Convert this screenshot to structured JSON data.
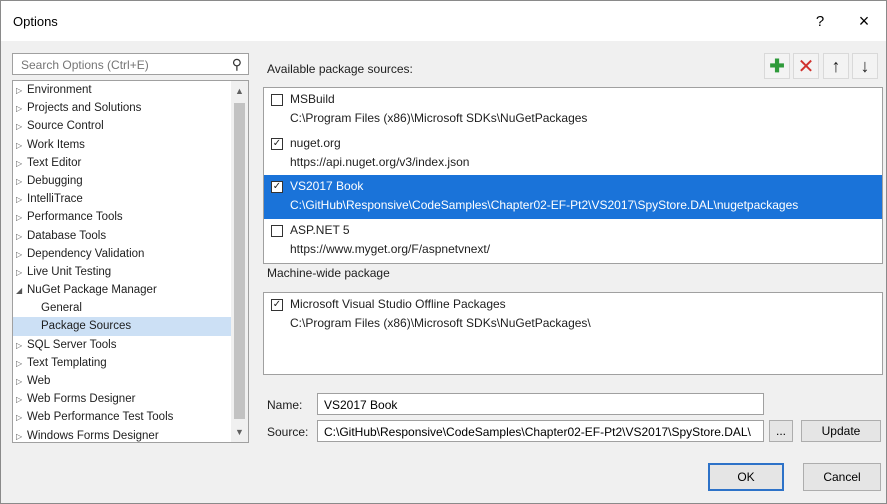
{
  "window": {
    "title": "Options",
    "help_label": "?",
    "close_label": "×"
  },
  "search": {
    "placeholder": "Search Options (Ctrl+E)",
    "value": ""
  },
  "tree": {
    "items": [
      {
        "label": "Environment",
        "expanded": false
      },
      {
        "label": "Projects and Solutions",
        "expanded": false
      },
      {
        "label": "Source Control",
        "expanded": false
      },
      {
        "label": "Work Items",
        "expanded": false
      },
      {
        "label": "Text Editor",
        "expanded": false
      },
      {
        "label": "Debugging",
        "expanded": false
      },
      {
        "label": "IntelliTrace",
        "expanded": false
      },
      {
        "label": "Performance Tools",
        "expanded": false
      },
      {
        "label": "Database Tools",
        "expanded": false
      },
      {
        "label": "Dependency Validation",
        "expanded": false
      },
      {
        "label": "Live Unit Testing",
        "expanded": false
      },
      {
        "label": "NuGet Package Manager",
        "expanded": true
      },
      {
        "label": "General",
        "child": true
      },
      {
        "label": "Package Sources",
        "child": true,
        "selected": true
      },
      {
        "label": "SQL Server Tools",
        "expanded": false
      },
      {
        "label": "Text Templating",
        "expanded": false
      },
      {
        "label": "Web",
        "expanded": false
      },
      {
        "label": "Web Forms Designer",
        "expanded": false
      },
      {
        "label": "Web Performance Test Tools",
        "expanded": false
      },
      {
        "label": "Windows Forms Designer",
        "expanded": false
      }
    ]
  },
  "available": {
    "label": "Available package sources:",
    "sources": [
      {
        "name": "MSBuild",
        "url": "C:\\Program Files (x86)\\Microsoft SDKs\\NuGetPackages",
        "checked": false,
        "selected": false
      },
      {
        "name": "nuget.org",
        "url": "https://api.nuget.org/v3/index.json",
        "checked": true,
        "selected": false
      },
      {
        "name": "VS2017 Book",
        "url": "C:\\GitHub\\Responsive\\CodeSamples\\Chapter02-EF-Pt2\\VS2017\\SpyStore.DAL\\nugetpackages",
        "checked": true,
        "selected": true
      },
      {
        "name": "ASP.NET 5",
        "url": "https://www.myget.org/F/aspnetvnext/",
        "checked": false,
        "selected": false
      }
    ]
  },
  "machine": {
    "label": "Machine-wide package",
    "sources": [
      {
        "name": "Microsoft Visual Studio Offline Packages",
        "url": "C:\\Program Files (x86)\\Microsoft SDKs\\NuGetPackages\\",
        "checked": true
      }
    ]
  },
  "form": {
    "name_label": "Name:",
    "name_value": "VS2017 Book",
    "source_label": "Source:",
    "source_value": "C:\\GitHub\\Responsive\\CodeSamples\\Chapter02-EF-Pt2\\VS2017\\SpyStore.DAL\\nugetpackages",
    "browse_label": "...",
    "update_label": "Update"
  },
  "buttons": {
    "ok": "OK",
    "cancel": "Cancel"
  },
  "colors": {
    "selection": "#1a73d9",
    "tree_selection": "#cce0f5",
    "add": "#2e9a3a",
    "remove": "#d0312d"
  },
  "icons": {
    "add": "plus-icon",
    "remove": "x-icon",
    "up": "arrow-up-icon",
    "down": "arrow-down-icon",
    "search": "search-icon"
  }
}
